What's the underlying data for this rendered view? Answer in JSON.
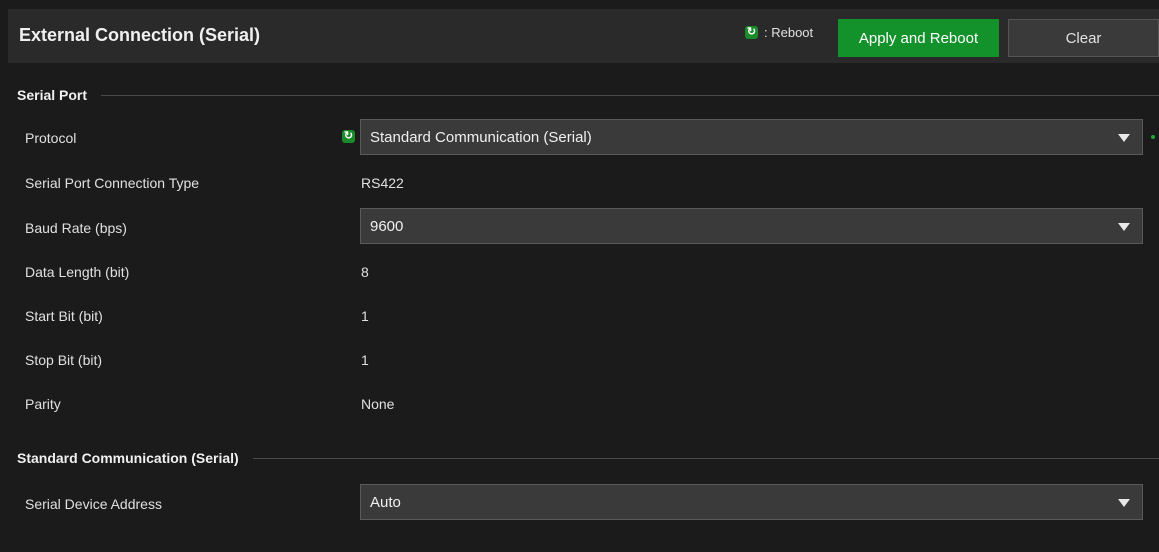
{
  "header": {
    "title": "External Connection (Serial)",
    "reboot_legend": ": Reboot",
    "apply_label": "Apply and Reboot",
    "clear_label": "Clear"
  },
  "serial_port": {
    "section_title": "Serial Port",
    "protocol": {
      "label": "Protocol",
      "value": "Standard Communication (Serial)"
    },
    "connection_type": {
      "label": "Serial Port Connection Type",
      "value": "RS422"
    },
    "baud_rate": {
      "label": "Baud Rate (bps)",
      "value": "9600"
    },
    "data_length": {
      "label": "Data Length (bit)",
      "value": "8"
    },
    "start_bit": {
      "label": "Start Bit (bit)",
      "value": "1"
    },
    "stop_bit": {
      "label": "Stop Bit (bit)",
      "value": "1"
    },
    "parity": {
      "label": "Parity",
      "value": "None"
    }
  },
  "standard_communication": {
    "section_title": "Standard Communication (Serial)",
    "device_address": {
      "label": "Serial Device Address",
      "value": "Auto"
    }
  },
  "colors": {
    "accent_green": "#13912b",
    "background": "#1b1b1b",
    "header_bg": "#2a2a2a"
  },
  "icons": {
    "reboot": "reboot-icon",
    "dropdown": "chevron-down-icon"
  }
}
